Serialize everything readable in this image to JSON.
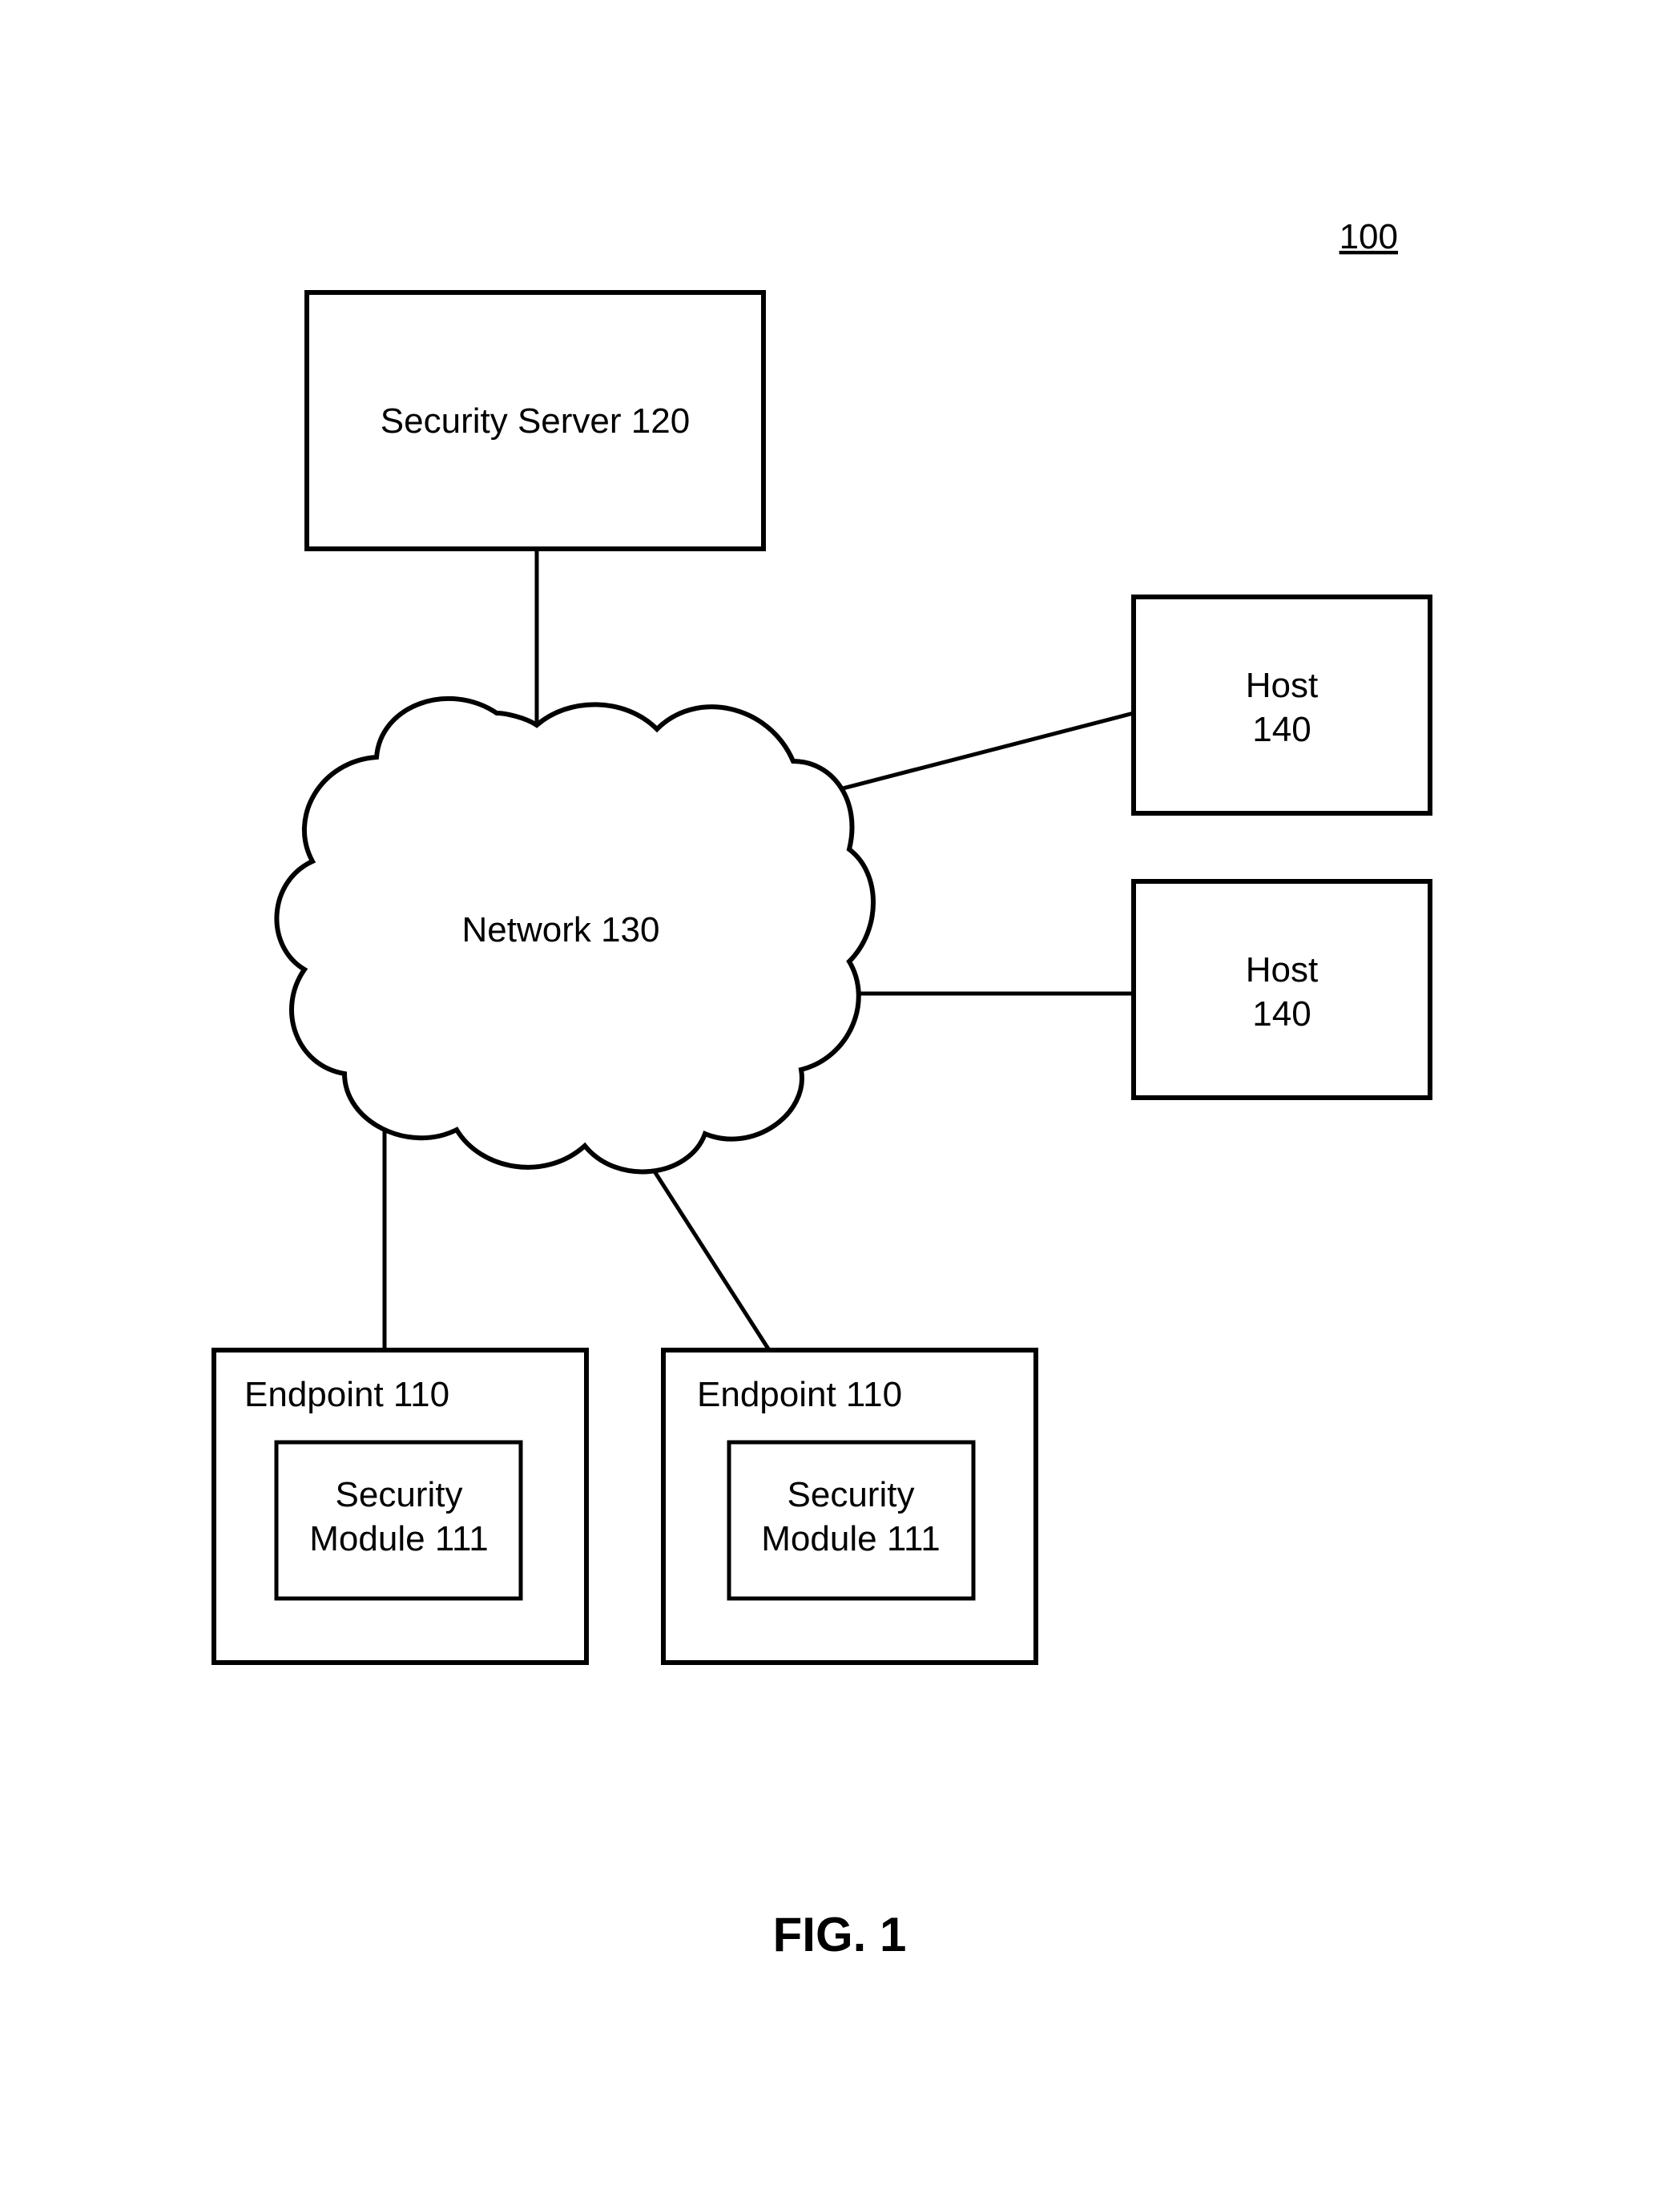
{
  "figureRef": "100",
  "securityServer": {
    "label": "Security Server 120"
  },
  "network": {
    "label": "Network 130"
  },
  "host1": {
    "line1": "Host",
    "line2": "140"
  },
  "host2": {
    "line1": "Host",
    "line2": "140"
  },
  "endpoint1": {
    "label": "Endpoint 110",
    "module": {
      "line1": "Security",
      "line2": "Module 111"
    }
  },
  "endpoint2": {
    "label": "Endpoint 110",
    "module": {
      "line1": "Security",
      "line2": "Module 111"
    }
  },
  "caption": "FIG. 1"
}
